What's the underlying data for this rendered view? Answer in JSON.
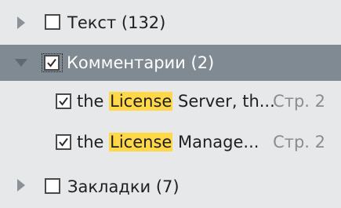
{
  "tree": {
    "text_node": {
      "label": "Текст (132)",
      "checked": false,
      "expanded": false
    },
    "comments_node": {
      "label": "Комментарии (2)",
      "checked": true,
      "expanded": true,
      "items": [
        {
          "prefix": "the ",
          "highlight": "License",
          "suffix": " Server, th...",
          "page": "Стр. 2",
          "checked": true
        },
        {
          "prefix": "the ",
          "highlight": "License",
          "suffix": "  Manage...",
          "page": "Стр. 2",
          "checked": true
        }
      ]
    },
    "bookmarks_node": {
      "label": "Закладки (7)",
      "checked": false,
      "expanded": false
    }
  },
  "colors": {
    "background": "#e6e8ea",
    "selected_row": "#7f8a93",
    "highlight": "#ffd84a",
    "page_text": "#8c8c8c"
  },
  "icons": {
    "collapsed": "chevron-right-icon",
    "expanded": "chevron-down-icon",
    "check": "checkmark-icon"
  }
}
